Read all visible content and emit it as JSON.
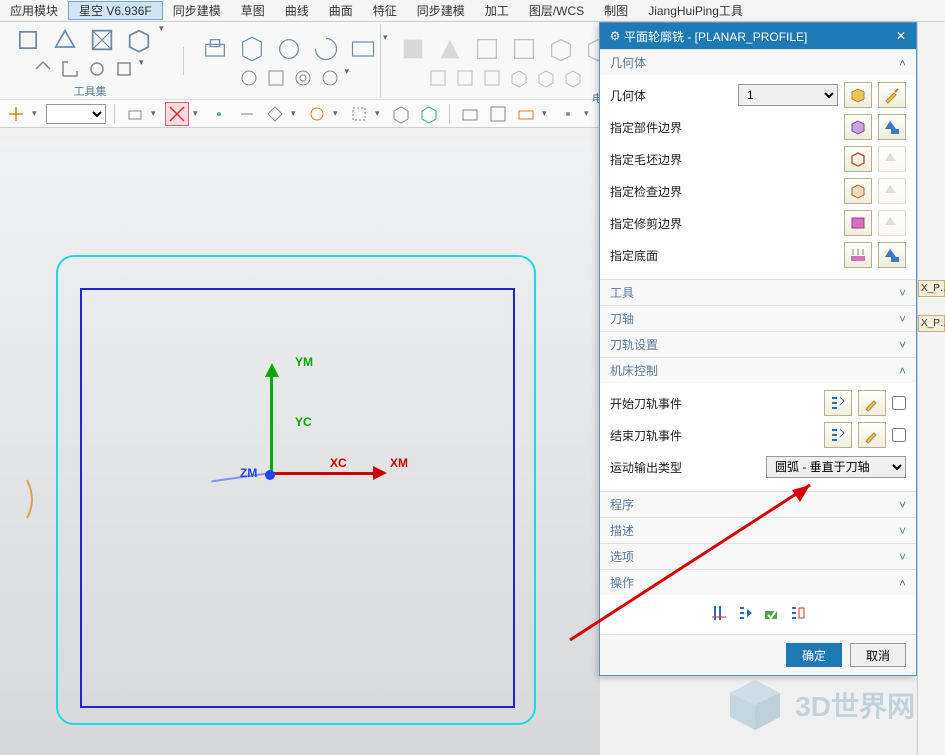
{
  "menu": [
    "应用模块",
    "星空 V6.936F",
    "同步建模",
    "草图",
    "曲线",
    "曲面",
    "特征",
    "同步建模",
    "加工",
    "图层/WCS",
    "制图",
    "JiangHuiPing工具"
  ],
  "menu_active_index": 1,
  "ribbon": {
    "group1_label": "工具集",
    "group2_label": "电极…"
  },
  "toolbar2_combo": "",
  "viewport": {
    "axis": {
      "ym": "YM",
      "yc": "YC",
      "xc": "XC",
      "xm": "XM",
      "zm": "ZM"
    }
  },
  "panel": {
    "title": "平面轮廓铣 - [PLANAR_PROFILE]",
    "sections": {
      "geom_hdr": "几何体",
      "geom_label": "几何体",
      "geom_value": "1",
      "part_boundary": "指定部件边界",
      "blank_boundary": "指定毛坯边界",
      "check_boundary": "指定检查边界",
      "trim_boundary": "指定修剪边界",
      "floor": "指定底面",
      "tool_hdr": "工具",
      "axis_hdr": "刀轴",
      "path_hdr": "刀轨设置",
      "mc_hdr": "机床控制",
      "start_event": "开始刀轨事件",
      "end_event": "结束刀轨事件",
      "motion_type_label": "运动输出类型",
      "motion_type_value": "圆弧 - 垂直于刀轴",
      "prog_hdr": "程序",
      "desc_hdr": "描述",
      "option_hdr": "选项",
      "action_hdr": "操作"
    },
    "footer": {
      "ok": "确定",
      "cancel": "取消"
    }
  },
  "rstrip": {
    "t1": "X_P…",
    "t2": "X_P…"
  },
  "watermark": "3D世界网"
}
